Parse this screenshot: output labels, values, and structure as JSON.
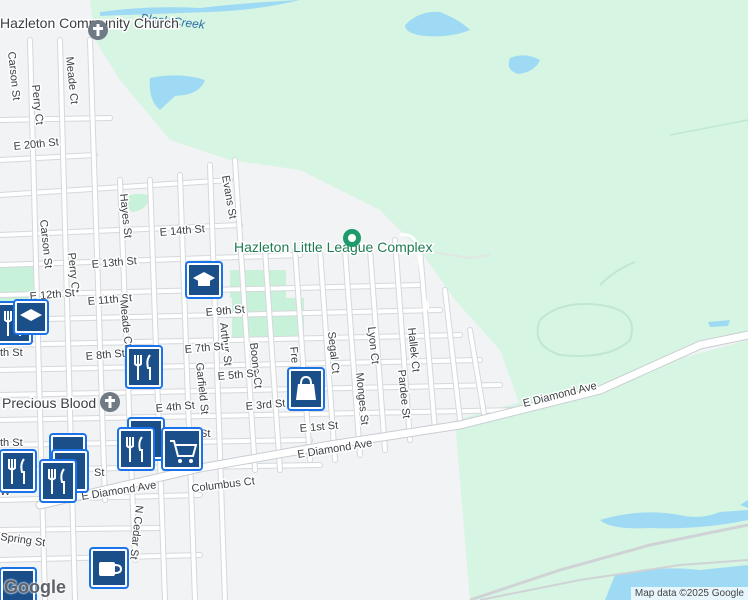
{
  "map": {
    "streets": [
      "Carson St",
      "Meade Ct",
      "Perry Ct",
      "E 20th St",
      "Evans St",
      "Hayes St",
      "E 14th St",
      "Carson St",
      "Perry Ct",
      "E 13th St",
      "E 12th St",
      "E 11th St",
      "Meade Ct",
      "E 9th St",
      "Arthur St",
      "E 8th St",
      "E 7th St",
      "Boone Ct",
      "Garfield St",
      "E 5th St",
      "Fre",
      "Segal Ct",
      "Lyon Ct",
      "Hallek Ct",
      "Monges St",
      "Pardee St",
      "E 4th St",
      "E 3rd St",
      "E 1st St",
      "E Diamond Ave",
      "E Diamond Ave",
      "Columbus Ct",
      "E Diamond Ave",
      "N Cedar St",
      "Spring St",
      "th St",
      "th St",
      "W",
      "St",
      "St"
    ],
    "water": [
      "Black Creek"
    ],
    "places": [
      "Hazleton Community Church",
      "Hazleton Little League Complex",
      "Precious Blood"
    ],
    "colors": {
      "park": "#c8f1d9",
      "open_land": "#d9f7e4",
      "water": "#9fdaf5",
      "road": "#ffffff",
      "poi_blue": "#1a73e8",
      "poi_dark": "#0f4c81",
      "park_pin": "#1e9b6a"
    },
    "icons": [
      "cross-icon",
      "school-icon",
      "shopping-bag-icon",
      "restaurant-icon",
      "shopping-cart-icon",
      "coffee-icon",
      "park-pin-icon"
    ],
    "attribution": "Map data ©2025 Google",
    "logo": "Google"
  }
}
